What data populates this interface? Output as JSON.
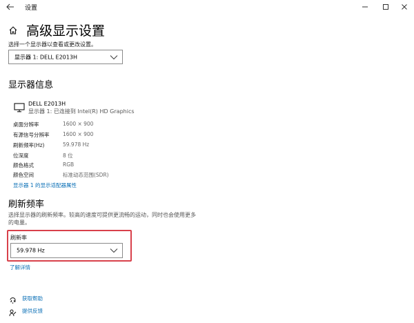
{
  "window": {
    "title": "设置",
    "back_icon": "arrow-left-icon",
    "controls": [
      "minimize-icon",
      "maximize-icon",
      "close-icon"
    ]
  },
  "page": {
    "title": "高级显示设置",
    "home_icon": "home-icon"
  },
  "display_select": {
    "prompt": "选择一个显示器以查看或更改设置。",
    "value": "显示器 1: DELL E2013H"
  },
  "display_info": {
    "section_title": "显示器信息",
    "monitor_name": "DELL E2013H",
    "monitor_sub": "显示器 1: 已连接到 Intel(R) HD Graphics",
    "rows": [
      {
        "key": "桌面分辨率",
        "value": "1600 × 900"
      },
      {
        "key": "有源信号分辨率",
        "value": "1600 × 900"
      },
      {
        "key": "刷新频率(Hz)",
        "value": "59.978 Hz"
      },
      {
        "key": "位深度",
        "value": "8 位"
      },
      {
        "key": "颜色格式",
        "value": "RGB"
      },
      {
        "key": "颜色空间",
        "value": "标准动态范围(SDR)"
      }
    ],
    "adapter_link": "显示器 1 的显示适配器属性"
  },
  "refresh": {
    "section_title": "刷新频率",
    "description": "选择显示器的刷新频率。较高的速度可提供更流畅的运动，同时也会使用更多的电量。",
    "field_label": "刷新率",
    "value": "59.978 Hz",
    "learn_more": "了解详情"
  },
  "footer": {
    "help": "获取帮助",
    "feedback": "提供反馈"
  },
  "colors": {
    "accent": "#0a6fb6",
    "highlight_border": "#d8404a"
  }
}
